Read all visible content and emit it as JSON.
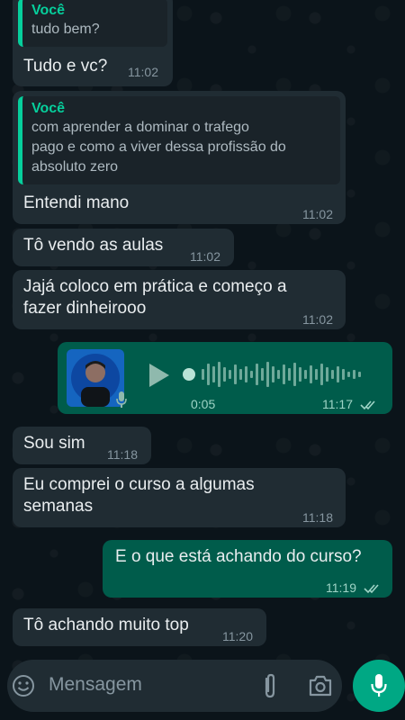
{
  "messages": [
    {
      "quote_author": "Você",
      "quote_text": "tudo bem?",
      "text": "Tudo e vc?",
      "time": "11:02"
    },
    {
      "quote_author": "Você",
      "quote_line1": "com aprender a dominar o trafego",
      "quote_line2": "pago e como a viver dessa profissão do",
      "quote_line3": "absoluto zero",
      "text": "Entendi mano",
      "time": "11:02"
    },
    {
      "text": "Tô vendo as aulas",
      "time": "11:02"
    },
    {
      "line1": "Jajá coloco em prática e começo a",
      "line2": "fazer dinheirooo",
      "time": "11:02"
    },
    {
      "type": "voice",
      "duration": "0:05",
      "time": "11:17",
      "status": "read"
    },
    {
      "text": "Sou sim",
      "time": "11:18"
    },
    {
      "line1": "Eu comprei o curso a algumas",
      "line2": "semanas",
      "time": "11:18"
    },
    {
      "text": "E o que está achando do curso?",
      "time": "11:19",
      "status": "read"
    },
    {
      "text": "Tô achando muito top",
      "time": "11:20"
    }
  ],
  "input": {
    "placeholder": "Mensagem"
  },
  "colors": {
    "accent": "#00a884",
    "incoming": "#202c33",
    "outgoing": "#005c4b",
    "read_ticks": "#53bdeb",
    "background": "#0b141a"
  }
}
